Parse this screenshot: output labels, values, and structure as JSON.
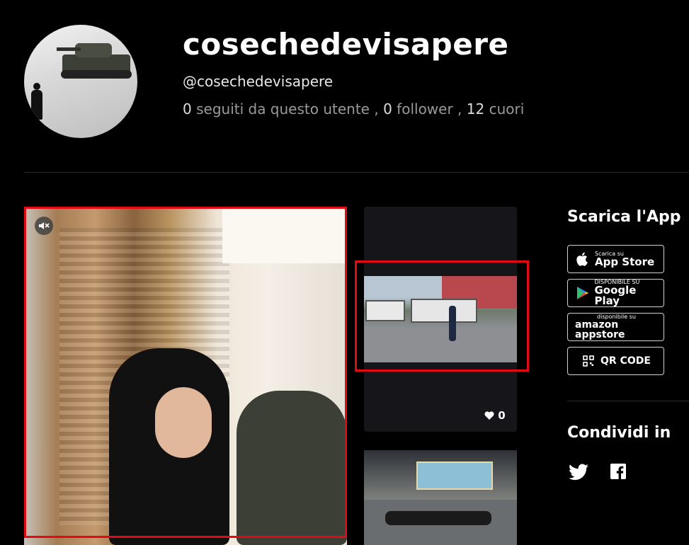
{
  "profile": {
    "name": "cosechedevisapere",
    "handle": "@cosechedevisapere",
    "following_count": "0",
    "following_label": "seguiti da questo utente",
    "followers_count": "0",
    "followers_label": "follower",
    "hearts_count": "12",
    "hearts_label": "cuori"
  },
  "videos": [
    {
      "muted": true
    },
    {
      "likes": "0"
    },
    {}
  ],
  "sidebar": {
    "download_title": "Scarica l'App",
    "stores": [
      {
        "icon": "apple-icon",
        "small": "Scarica su",
        "big": "App Store"
      },
      {
        "icon": "google-play-icon",
        "small": "DISPONIBILE SU",
        "big": "Google Play"
      },
      {
        "icon": "amazon-icon",
        "small": "disponibile su",
        "big": "amazon appstore"
      },
      {
        "icon": "qr-code-icon",
        "small": "",
        "big": "QR CODE"
      }
    ],
    "share_title": "Condividi in",
    "social": [
      "twitter-icon",
      "facebook-icon"
    ]
  },
  "colors": {
    "background": "#000000",
    "highlight": "#e50914",
    "muted_text": "#9a9a9a"
  }
}
